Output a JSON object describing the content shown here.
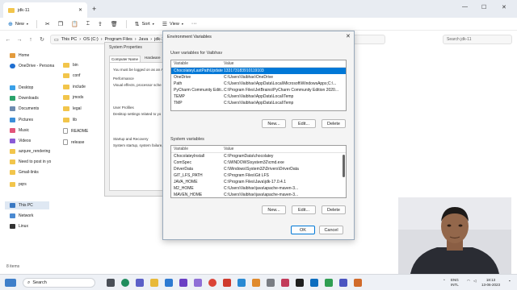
{
  "explorer": {
    "tab_title": "jdk-11",
    "toolbar": {
      "new_label": "New",
      "sort_label": "Sort",
      "view_label": "View"
    },
    "breadcrumb": [
      "This PC",
      "OS (C:)",
      "Program Files",
      "Java",
      "jdk-11"
    ],
    "search_placeholder": "Search jdk-11",
    "sidebar": {
      "home": "Home",
      "onedrive": "OneDrive - Persona",
      "items": [
        "Desktop",
        "Downloads",
        "Documents",
        "Pictures",
        "Music",
        "Videos",
        "azqure_rendering",
        "Need to post in yo",
        "Gmail-links",
        "pqrs"
      ],
      "this_pc": "This PC",
      "network": "Network",
      "linux": "Linux"
    },
    "files": [
      "bin",
      "conf",
      "include",
      "jmods",
      "legal",
      "lib",
      "README",
      "release"
    ],
    "status": "8 items"
  },
  "system_properties": {
    "title": "System Properties",
    "tabs": [
      "Computer Name",
      "Hardware",
      "Adv"
    ],
    "logged_text": "You must be logged on as an A",
    "performance_label": "Performance",
    "performance_text": "Visual effects, processor sche",
    "user_profiles_label": "User Profiles",
    "user_profiles_text": "Desktop settings related to yo",
    "startup_label": "Startup and Recovery",
    "startup_text": "System startup, system failure,"
  },
  "env_dialog": {
    "title": "Environment Variables",
    "user_group_label": "User variables for Vaibhav",
    "col_variable": "Variable",
    "col_value": "Value",
    "user_vars": [
      {
        "name": "ChocolateyLastPathUpdate",
        "value": "133173183910119103"
      },
      {
        "name": "OneDrive",
        "value": "C:\\Users\\Vaibhav\\OneDrive"
      },
      {
        "name": "Path",
        "value": "C:\\Users\\Vaibhav\\AppData\\Local\\Microsoft\\WindowsApps;C:\\..."
      },
      {
        "name": "PyCharm Community Editi...",
        "value": "C:\\Program Files\\JetBrains\\PyCharm Community Edition 2020..."
      },
      {
        "name": "TEMP",
        "value": "C:\\Users\\Vaibhav\\AppData\\Local\\Temp"
      },
      {
        "name": "TMP",
        "value": "C:\\Users\\Vaibhav\\AppData\\Local\\Temp"
      }
    ],
    "user_buttons": {
      "new": "New...",
      "edit": "Edit...",
      "delete": "Delete"
    },
    "system_group_label": "System variables",
    "system_vars": [
      {
        "name": "ChocolateyInstall",
        "value": "C:\\ProgramData\\chocolatey"
      },
      {
        "name": "ComSpec",
        "value": "C:\\WINDOWS\\system32\\cmd.exe"
      },
      {
        "name": "DriverData",
        "value": "C:\\Windows\\System32\\Drivers\\DriverData"
      },
      {
        "name": "GIT_LFS_PATH",
        "value": "C:\\Program Files\\Git LFS"
      },
      {
        "name": "JAVA_HOME",
        "value": "C:\\Program Files\\Java\\jdk-17.0.4.1"
      },
      {
        "name": "M2_HOME",
        "value": "C:\\Users\\Vaibhav\\java\\apache-maven-3..."
      },
      {
        "name": "MAVEN_HOME",
        "value": "C:\\Users\\Vaibhav\\java\\apache-maven-3..."
      }
    ],
    "system_buttons": {
      "new": "New...",
      "edit": "Edit...",
      "delete": "Delete"
    },
    "ok": "OK",
    "cancel": "Cancel"
  },
  "taskbar": {
    "search_placeholder": "Search",
    "tray": {
      "lang_line1": "ENG",
      "lang_line2": "INTL",
      "time": "18:13",
      "date": "13-06-2023"
    }
  },
  "colors": {
    "accent": "#0078d7",
    "folder": "#f2c54b",
    "taskbar": "#eef1f6"
  }
}
